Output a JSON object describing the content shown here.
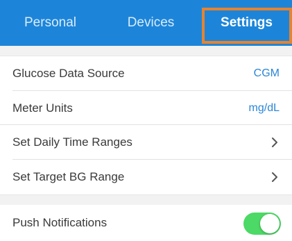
{
  "tabs": {
    "personal": "Personal",
    "devices": "Devices",
    "settings": "Settings",
    "active": "settings"
  },
  "rows": {
    "glucose_source": {
      "label": "Glucose Data Source",
      "value": "CGM"
    },
    "meter_units": {
      "label": "Meter Units",
      "value": "mg/dL"
    },
    "daily_time_ranges": {
      "label": "Set Daily Time Ranges",
      "icon": "chevron-right-icon"
    },
    "target_bg_range": {
      "label": "Set Target BG Range",
      "icon": "chevron-right-icon"
    },
    "push_notifications": {
      "label": "Push Notifications",
      "enabled": true
    }
  },
  "colors": {
    "tabbar": "#1d85d9",
    "highlight": "#e6832f",
    "value_text": "#2a86d6",
    "toggle_on": "#4cd965"
  }
}
